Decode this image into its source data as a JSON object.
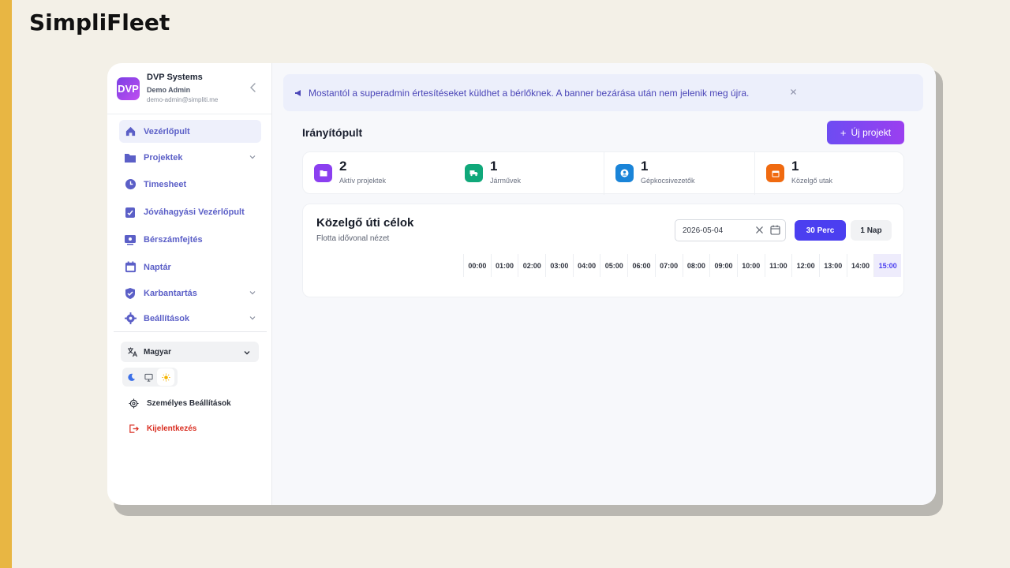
{
  "page": {
    "heading": "SimpliFleet"
  },
  "sidebar": {
    "org_name": "DVP Systems",
    "logo_text": "DVP",
    "user_name": "Demo Admin",
    "user_email": "demo-admin@simpliti.me",
    "nav": [
      {
        "label": "Vezérlőpult",
        "icon": "home-icon",
        "active": true
      },
      {
        "label": "Projektek",
        "icon": "folder-icon",
        "has_submenu": true
      },
      {
        "label": "Timesheet",
        "icon": "clock-icon"
      },
      {
        "label": "Jóváhagyási Vezérlőpult",
        "icon": "clipboard-check-icon"
      },
      {
        "label": "Bérszámfejtés",
        "icon": "payroll-icon"
      },
      {
        "label": "Naptár",
        "icon": "calendar-icon"
      },
      {
        "label": "Karbantartás",
        "icon": "shield-check-icon",
        "has_submenu": true
      },
      {
        "label": "Beállítások",
        "icon": "gear-icon",
        "has_submenu": true
      }
    ],
    "language": "Magyar",
    "theme_options": [
      "dark",
      "system",
      "light"
    ],
    "theme_selected": "light",
    "personal_settings": "Személyes Beállítások",
    "logout": "Kijelentkezés"
  },
  "banner": {
    "text": "Mostantól a superadmin értesítéseket küldhet a bérlőknek. A banner bezárása után nem jelenik meg újra."
  },
  "dashboard": {
    "title": "Irányítópult",
    "new_project_label": "Új projekt",
    "stats": [
      {
        "value": "2",
        "label": "Aktív projektek",
        "color": "#8b3ff0",
        "icon": "folder-icon"
      },
      {
        "value": "1",
        "label": "Járművek",
        "color": "#10a87a",
        "icon": "truck-icon"
      },
      {
        "value": "1",
        "label": "Gépkocsivezetők",
        "color": "#1a84d8",
        "icon": "user-circle-icon"
      },
      {
        "value": "1",
        "label": "Közelgő utak",
        "color": "#f06a10",
        "icon": "calendar-icon"
      }
    ]
  },
  "timeline": {
    "title": "Közelgő úti célok",
    "subtitle": "Flotta idővonal nézet",
    "date": "2026-05-04",
    "interval_options": [
      "30 Perc",
      "1 Nap"
    ],
    "interval_selected": "30 Perc",
    "hours": [
      "00:00",
      "01:00",
      "02:00",
      "03:00",
      "04:00",
      "05:00",
      "06:00",
      "07:00",
      "08:00",
      "09:00",
      "10:00",
      "11:00",
      "12:00",
      "13:00",
      "14:00",
      "15:00"
    ],
    "current_hour": "15:00"
  },
  "colors": {
    "accent": "#4b3ff0",
    "danger": "#d92d20",
    "nav_text": "#5b5fc7"
  }
}
